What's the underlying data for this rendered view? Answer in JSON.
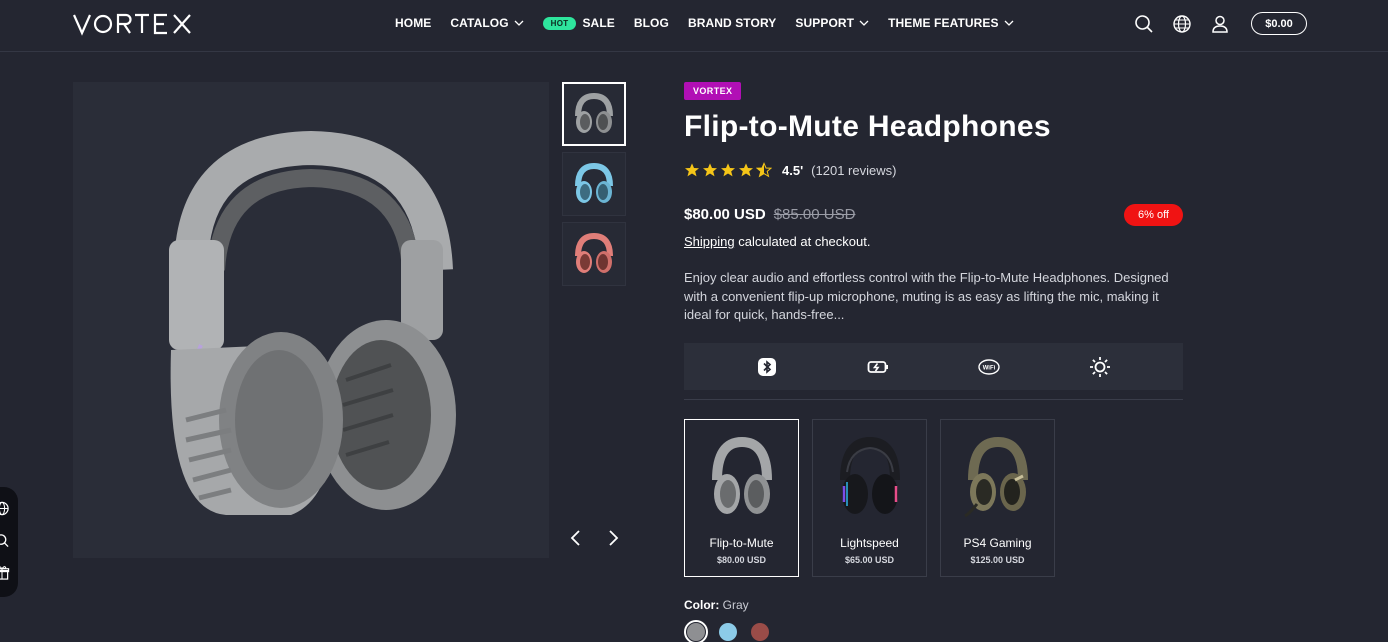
{
  "header": {
    "logo_text": "VORTEX",
    "nav": [
      {
        "label": "HOME",
        "has_dropdown": false
      },
      {
        "label": "CATALOG",
        "has_dropdown": true
      },
      {
        "label": "SALE",
        "badge": "HOT",
        "has_dropdown": false
      },
      {
        "label": "BLOG",
        "has_dropdown": false
      },
      {
        "label": "BRAND STORY",
        "has_dropdown": false
      },
      {
        "label": "SUPPORT",
        "has_dropdown": true
      },
      {
        "label": "THEME FEATURES",
        "has_dropdown": true
      }
    ],
    "icons": [
      "search-icon",
      "globe-icon",
      "account-icon"
    ],
    "cart_total": "$0.00"
  },
  "gallery": {
    "main_image": "gray-headphones",
    "thumbnails": [
      {
        "color": "#9ea1a3",
        "name": "Gray"
      },
      {
        "color": "#7cc7e6",
        "name": "Blue"
      },
      {
        "color": "#e07e79",
        "name": "Red"
      }
    ],
    "active_thumbnail": 0
  },
  "product": {
    "brand": "VORTEX",
    "title": "Flip-to-Mute Headphones",
    "rating": 4.5,
    "rating_label": "4.5'",
    "reviews": "(1201 reviews)",
    "price": "$80.00 USD",
    "compare_price": "$85.00 USD",
    "discount": "6% off",
    "shipping_link": "Shipping",
    "shipping_text": " calculated at checkout.",
    "description": "Enjoy clear audio and effortless control with the Flip-to-Mute Headphones. Designed with a convenient flip-up microphone, muting is as easy as lifting the mic, making it ideal for quick, hands-free...",
    "features": [
      "bluetooth-icon",
      "battery-charging-icon",
      "wifi-icon",
      "brightness-icon"
    ],
    "variants": [
      {
        "name": "Flip-to-Mute",
        "price": "$80.00 USD",
        "active": true
      },
      {
        "name": "Lightspeed",
        "price": "$65.00 USD",
        "active": false
      },
      {
        "name": "PS4 Gaming",
        "price": "$125.00 USD",
        "active": false
      }
    ],
    "color_label": "Color:",
    "color_value": "Gray",
    "colors": [
      {
        "name": "Gray",
        "hex": "#8e8f92",
        "active": true
      },
      {
        "name": "Blue",
        "hex": "#8ccbe8",
        "active": false
      },
      {
        "name": "Red",
        "hex": "#9a4c48",
        "active": false
      }
    ]
  },
  "colors": {
    "background": "#242631",
    "accent_hot": "#2ee59d",
    "brand_badge": "#b10fb5",
    "discount": "#f01313",
    "star": "#f5c518"
  }
}
